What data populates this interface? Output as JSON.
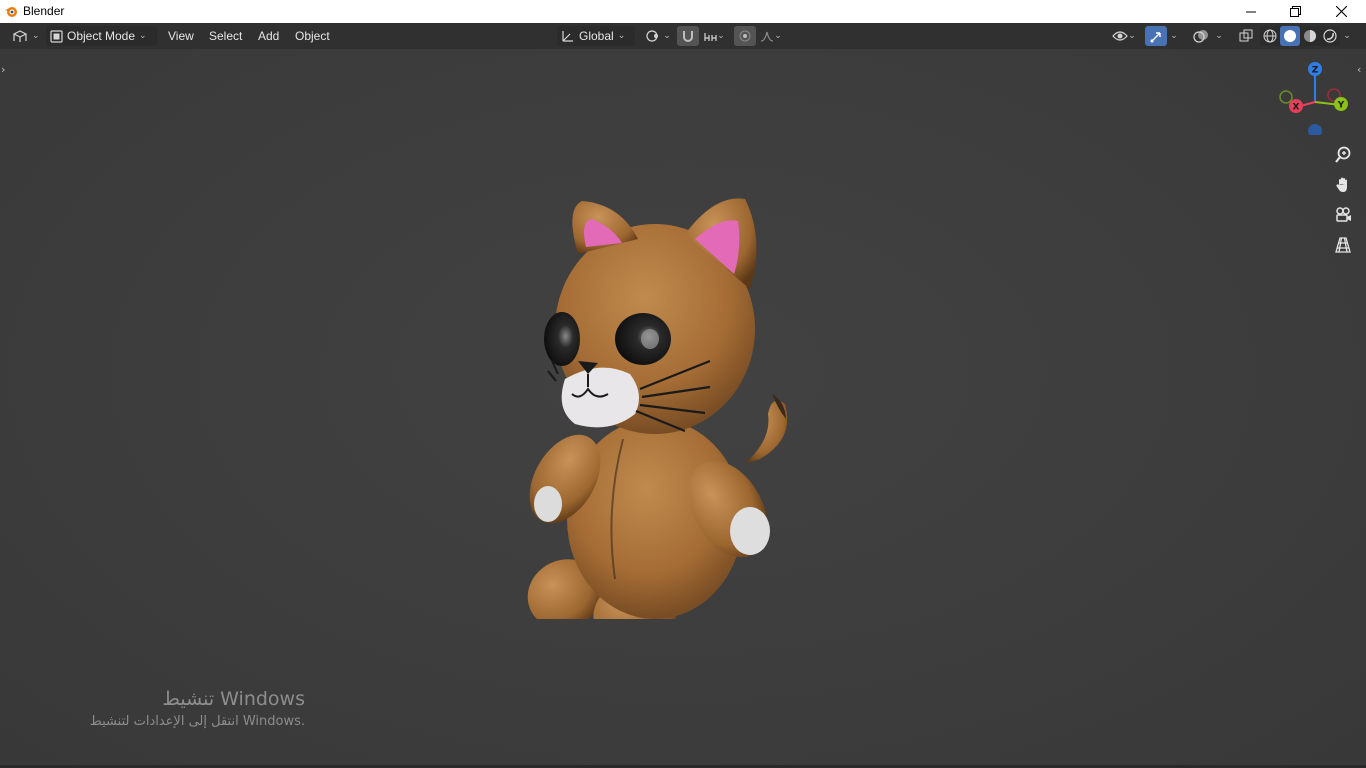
{
  "window": {
    "title": "Blender",
    "controls": [
      "minimize-icon",
      "restore-icon",
      "close-icon"
    ]
  },
  "header": {
    "editor_type_icon": "3d-viewport-icon",
    "mode": "Object Mode",
    "menus": [
      "View",
      "Select",
      "Add",
      "Object"
    ],
    "orientation": "Global",
    "pivot_icon": "pivot-point-icon",
    "snap_icon": "magnet-icon",
    "snap_target_icon": "snap-increment-icon",
    "proportional_icon": "proportional-edit-icon",
    "falloff_icon": "falloff-curve-icon",
    "visibility_icon": "eye-icon",
    "gizmo_icon": "gizmo-icon",
    "overlay_icon": "overlay-icon",
    "xray_icon": "xray-icon",
    "shading_modes": [
      "wireframe",
      "solid",
      "material-preview",
      "rendered"
    ],
    "active_shading": "solid",
    "accent_color": "#4772b3"
  },
  "gizmo": {
    "axes": {
      "z": "Z",
      "x": "X",
      "y": "Y"
    },
    "colors": {
      "z": "#2f7ee6",
      "x": "#e8405a",
      "y": "#8bc219"
    }
  },
  "nav_tools": [
    "zoom-icon",
    "pan-hand-icon",
    "camera-view-icon",
    "perspective-grid-icon"
  ],
  "watermark": {
    "line1": "تنشيط Windows",
    "line2": "انتقل إلى الإعدادات لتنشيط Windows."
  }
}
